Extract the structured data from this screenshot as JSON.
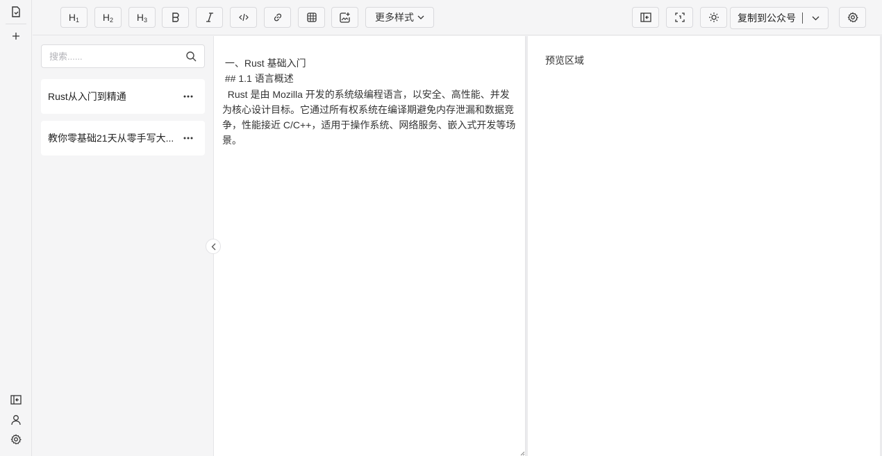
{
  "toolbar": {
    "h1": {
      "main": "H",
      "sub": "1"
    },
    "h2": {
      "main": "H",
      "sub": "2"
    },
    "h3": {
      "main": "H",
      "sub": "3"
    },
    "more_styles": "更多样式",
    "copy_to": "复制到公众号"
  },
  "sidebar": {
    "search_placeholder": "搜索......",
    "documents": [
      {
        "title": "Rust从入门到精通"
      },
      {
        "title": "教你零基础21天从零手写大..."
      }
    ]
  },
  "editor": {
    "content": " 一、Rust 基础入门\n ## 1.1 语言概述\n  Rust 是由 Mozilla 开发的系统级编程语言，以安全、高性能、并发为核心设计目标。它通过所有权系统在编译期避免内存泄漏和数据竞争，性能接近 C/C++，适用于操作系统、网络服务、嵌入式开发等场景。"
  },
  "preview": {
    "placeholder": "预览区域"
  },
  "icons": {
    "rail_top": [
      "new-file-icon",
      "plus-icon"
    ],
    "rail_bottom": [
      "collapse-sidebar-icon",
      "user-icon",
      "settings-icon"
    ],
    "toolbar_right": [
      "layout-icon",
      "fullscreen-icon",
      "theme-sun-icon",
      "settings-icon"
    ]
  }
}
